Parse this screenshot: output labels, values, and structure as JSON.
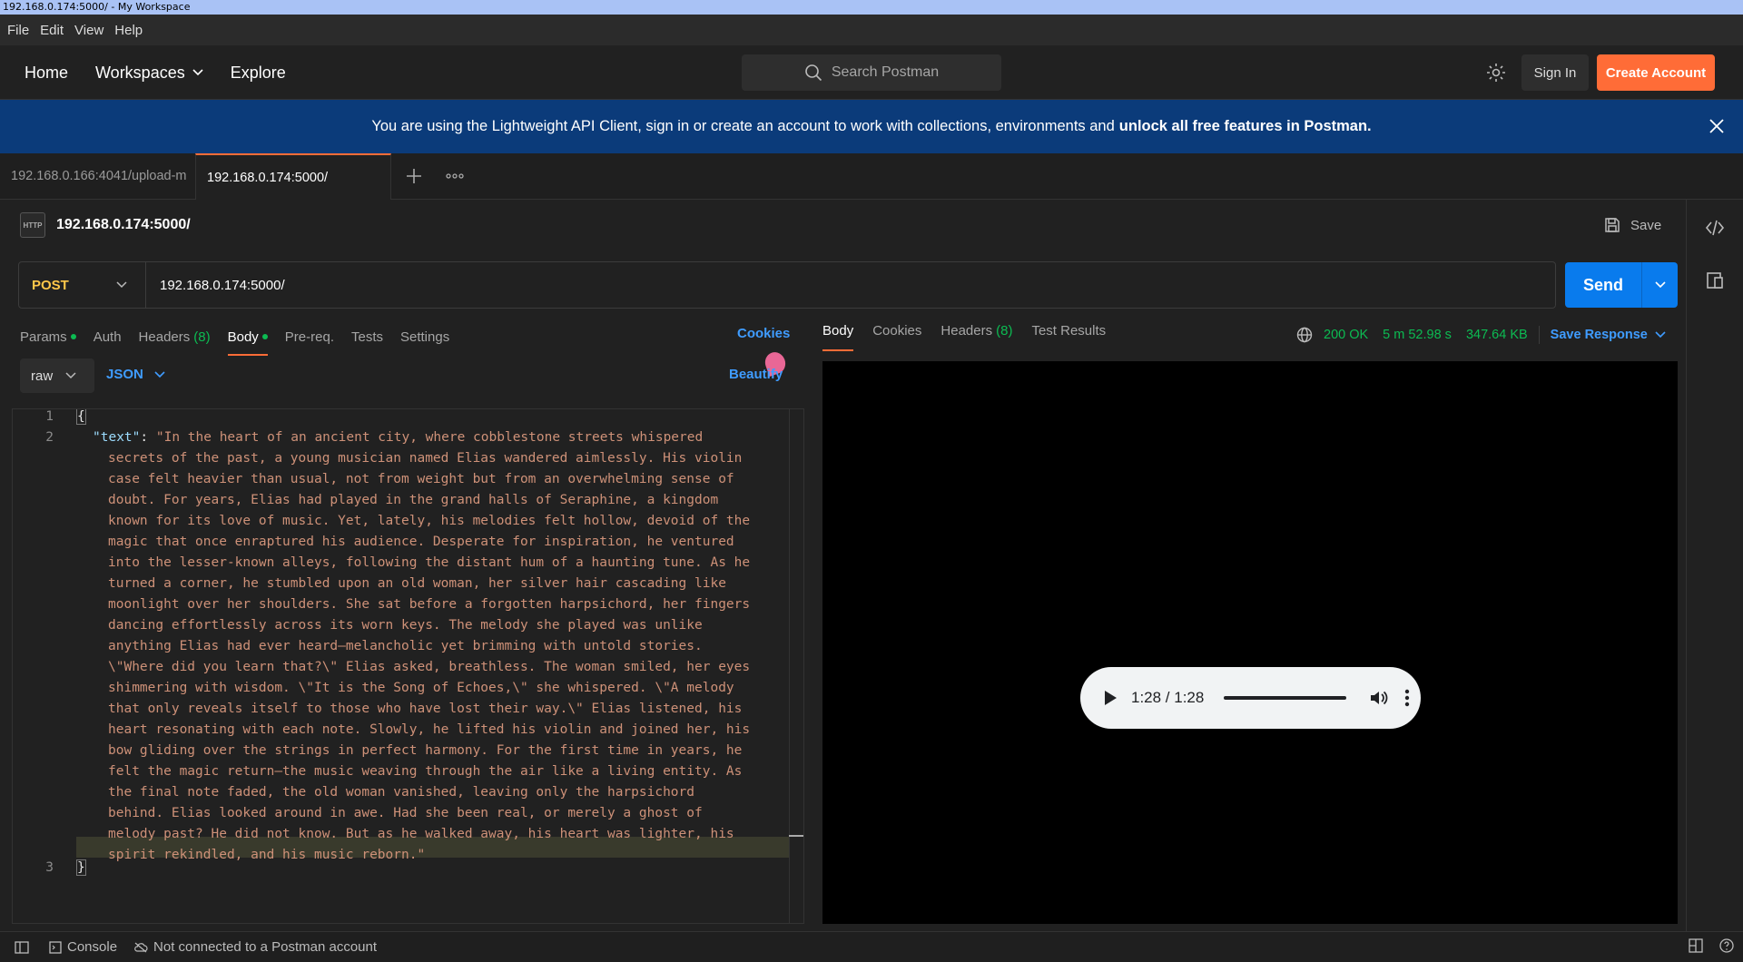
{
  "window": {
    "title": "192.168.0.174:5000/ - My Workspace"
  },
  "menu": [
    "File",
    "Edit",
    "View",
    "Help"
  ],
  "nav": {
    "home": "Home",
    "workspaces": "Workspaces",
    "explore": "Explore"
  },
  "search": {
    "placeholder": "Search Postman"
  },
  "auth": {
    "signin": "Sign In",
    "create": "Create Account"
  },
  "banner": {
    "text": "You are using the Lightweight API Client, sign in or create an account to work with collections, environments and",
    "bold": "unlock all free features in Postman."
  },
  "tabs": [
    {
      "label": "192.168.0.166:4041/upload-m"
    },
    {
      "label": "192.168.0.174:5000/"
    }
  ],
  "request": {
    "name": "192.168.0.174:5000/",
    "badge": "HTTP",
    "save": "Save",
    "method": "POST",
    "url": "192.168.0.174:5000/",
    "send": "Send"
  },
  "reqtabs": {
    "params": "Params",
    "auth": "Auth",
    "headers": "Headers",
    "headers_count": "(8)",
    "body": "Body",
    "prereq": "Pre-req.",
    "tests": "Tests",
    "settings": "Settings",
    "cookies": "Cookies"
  },
  "body": {
    "mode": "raw",
    "format": "JSON",
    "beautify": "Beautify"
  },
  "editor": {
    "line_numbers": [
      "1",
      "2",
      "3"
    ],
    "open_brace": "{",
    "close_brace": "}",
    "key": "\"text\"",
    "colon": ": ",
    "lines": [
      "\"In the heart of an ancient city, where cobblestone streets whispered",
      "secrets of the past, a young musician named Elias wandered aimlessly. His violin",
      "case felt heavier than usual, not from weight but from an overwhelming sense of",
      "doubt. For years, Elias had played in the grand halls of Seraphine, a kingdom",
      "known for its love of music. Yet, lately, his melodies felt hollow, devoid of the",
      "magic that once enraptured his audience. Desperate for inspiration, he ventured",
      "into the lesser-known alleys, following the distant hum of a haunting tune. As he",
      "turned a corner, he stumbled upon an old woman, her silver hair cascading like",
      "moonlight over her shoulders. She sat before a forgotten harpsichord, her fingers",
      "dancing effortlessly across its worn keys. The melody she played was unlike",
      "anything Elias had ever heard—melancholic yet brimming with untold stories.",
      "\\\"Where did you learn that?\\\" Elias asked, breathless. The woman smiled, her eyes",
      "shimmering with wisdom. \\\"It is the Song of Echoes,\\\" she whispered. \\\"A melody",
      "that only reveals itself to those who have lost their way.\\\" Elias listened, his",
      "heart resonating with each note. Slowly, he lifted his violin and joined her, his",
      "bow gliding over the strings in perfect harmony. For the first time in years, he",
      "felt the magic return—the music weaving through the air like a living entity. As",
      "the final note faded, the old woman vanished, leaving only the harpsichord",
      "behind. Elias looked around in awe. Had she been real, or merely a ghost of",
      "melody past? He did not know. But as he walked away, his heart was lighter, his",
      "spirit rekindled, and his music reborn.\""
    ]
  },
  "response": {
    "tabs": {
      "body": "Body",
      "cookies": "Cookies",
      "headers": "Headers",
      "headers_count": "(8)",
      "tests": "Test Results"
    },
    "status": "200 OK",
    "time": "5 m 52.98 s",
    "size": "347.64 KB",
    "save": "Save Response",
    "player": {
      "time": "1:28 / 1:28"
    }
  },
  "statusbar": {
    "console": "Console",
    "account": "Not connected to a Postman account"
  }
}
